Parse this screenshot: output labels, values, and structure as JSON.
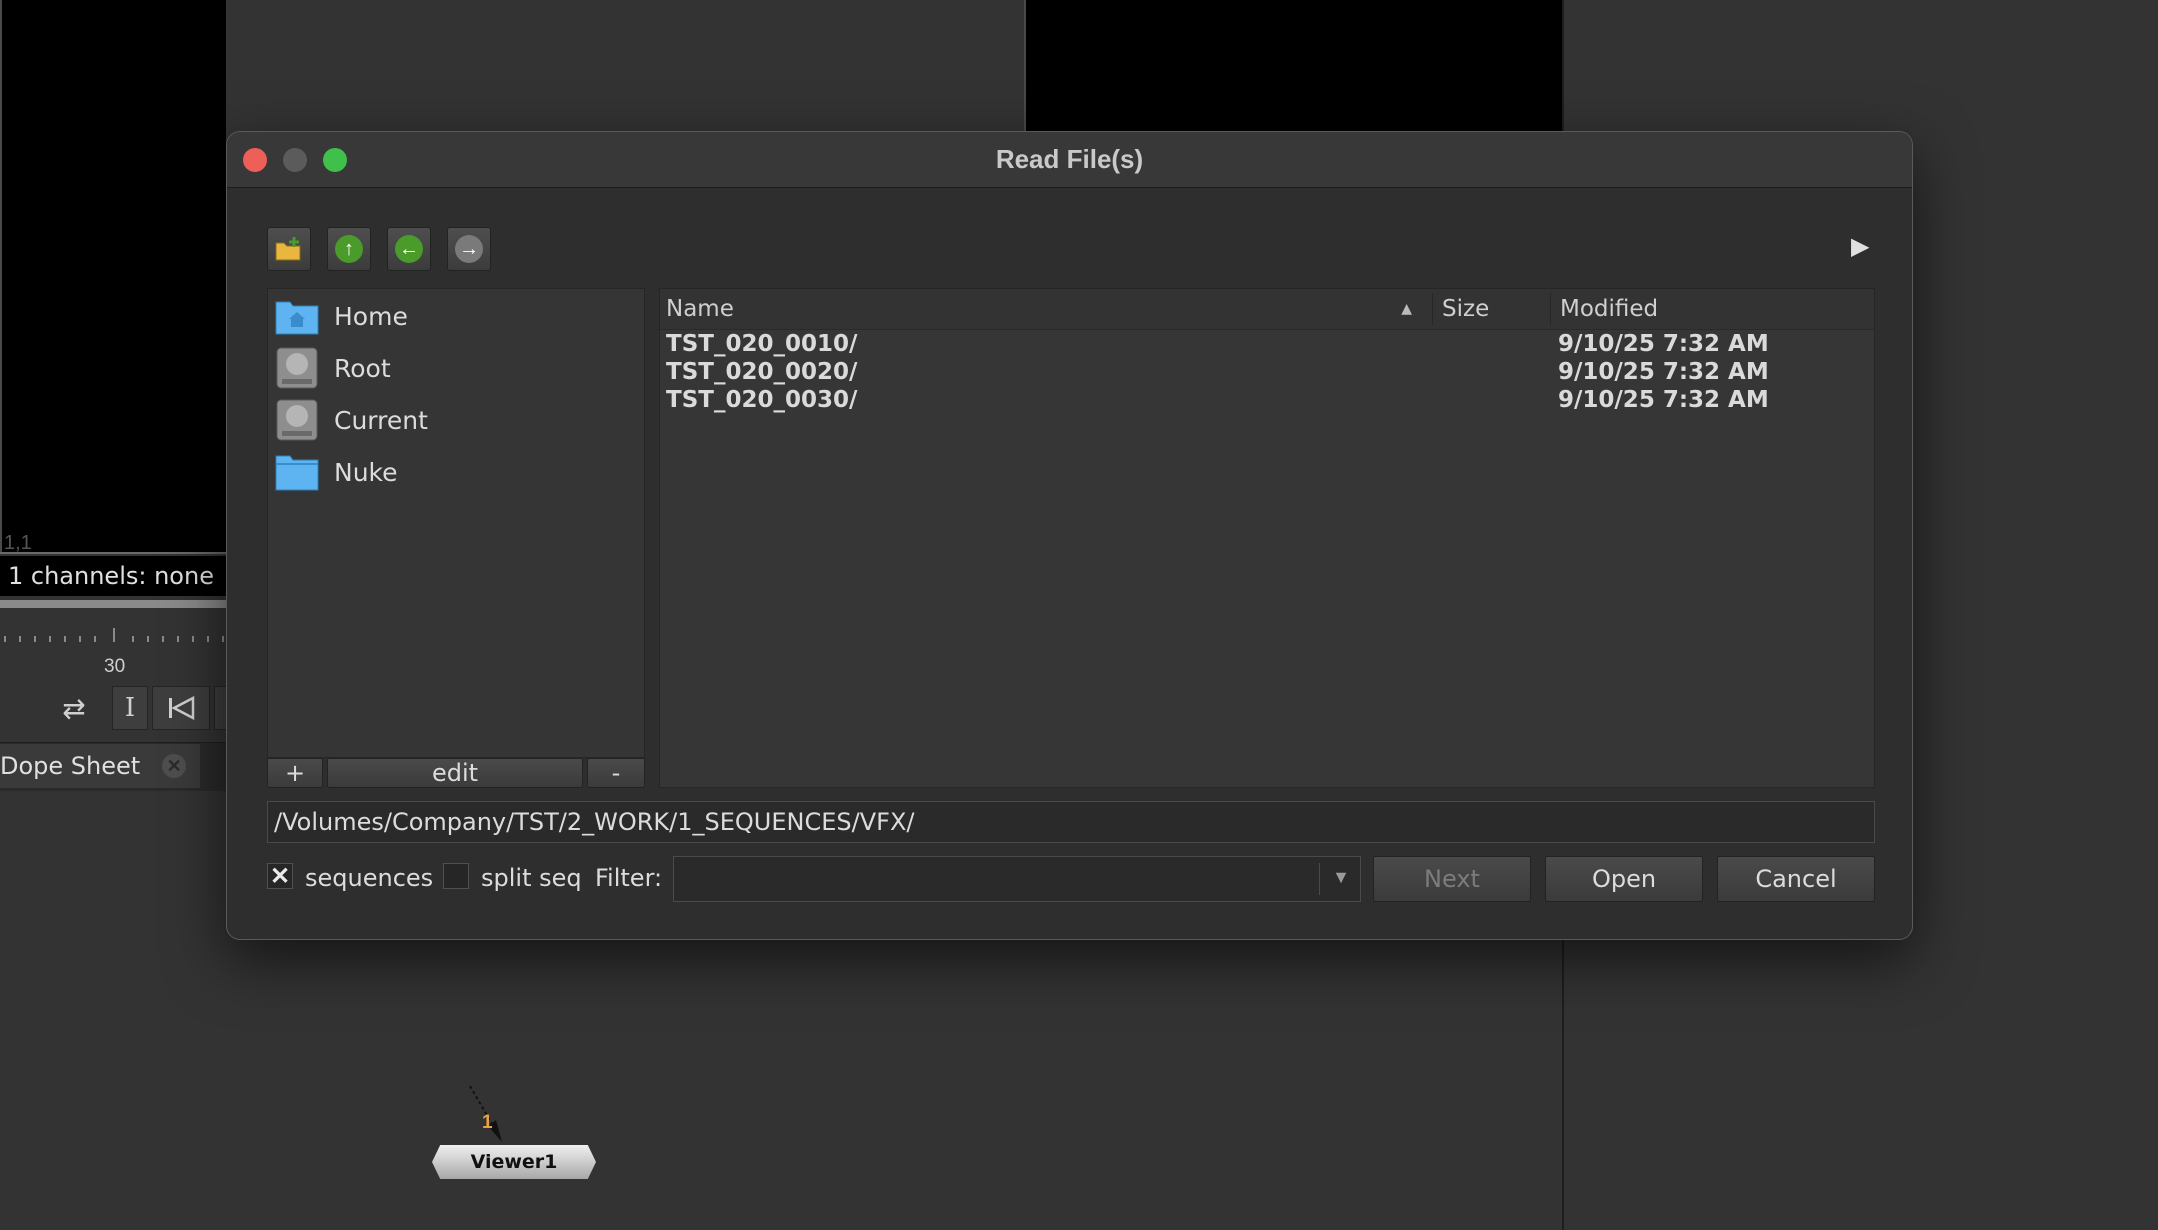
{
  "background": {
    "viewer_coords": "1,1",
    "channels_label": "1 channels: none",
    "timeline_tick": "30",
    "dope_sheet_tab": "Dope Sheet",
    "viewer_node_label": "Viewer1",
    "viewer_node_input": "1"
  },
  "dialog": {
    "title": "Read File(s)",
    "toolbar": {
      "new_folder_icon": "new-folder-icon",
      "up_icon": "arrow-up-icon",
      "back_icon": "arrow-left-icon",
      "forward_icon": "arrow-right-icon",
      "preview_toggle": "▶"
    },
    "favorites": [
      {
        "label": "Home",
        "icon": "home-folder-icon"
      },
      {
        "label": "Root",
        "icon": "hard-drive-icon"
      },
      {
        "label": "Current",
        "icon": "hard-drive-icon"
      },
      {
        "label": "Nuke",
        "icon": "folder-icon"
      }
    ],
    "favorites_buttons": {
      "add": "+",
      "edit": "edit",
      "remove": "-"
    },
    "columns": {
      "name": "Name",
      "size": "Size",
      "modified": "Modified"
    },
    "files": [
      {
        "name": "TST_020_0010/",
        "size": "",
        "modified": "9/10/25 7:32 AM"
      },
      {
        "name": "TST_020_0020/",
        "size": "",
        "modified": "9/10/25 7:32 AM"
      },
      {
        "name": "TST_020_0030/",
        "size": "",
        "modified": "9/10/25 7:32 AM"
      }
    ],
    "path": "/Volumes/Company/TST/2_WORK/1_SEQUENCES/VFX/",
    "options": {
      "sequences_label": "sequences",
      "sequences_checked": true,
      "split_seq_label": "split seq",
      "split_seq_checked": false,
      "filter_label": "Filter:",
      "filter_value": ""
    },
    "buttons": {
      "next": "Next",
      "open": "Open",
      "cancel": "Cancel"
    }
  },
  "colors": {
    "close": "#ed5f57",
    "minimize": "#5b5b5b",
    "zoom": "#3fc04a",
    "icon_green": "#4a9b2a",
    "folder_blue": "#5db4f0",
    "node_accent": "#e7a24a"
  }
}
